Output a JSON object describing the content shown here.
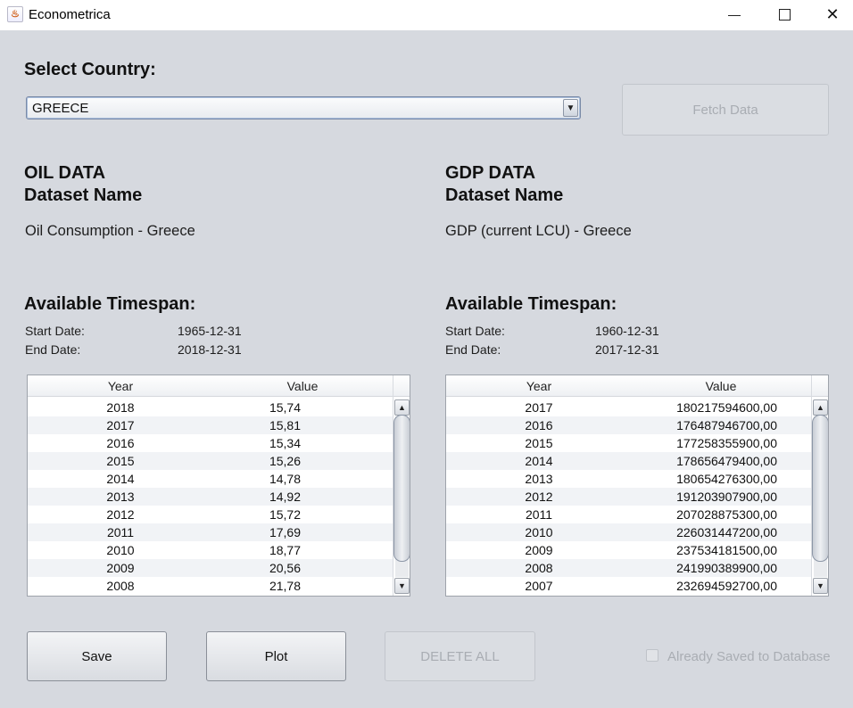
{
  "window": {
    "title": "Econometrica",
    "app_icon_glyph": "♨",
    "minimize_glyph": "",
    "close_glyph": "✕"
  },
  "country": {
    "label": "Select Country:",
    "selected": "GREECE",
    "dropdown_arrow": "▼",
    "fetch_button": "Fetch Data"
  },
  "oil": {
    "heading_line1": "OIL DATA",
    "heading_line2": "Dataset Name",
    "dataset_name": "Oil Consumption - Greece",
    "timespan_heading": "Available Timespan:",
    "start_label": "Start Date:",
    "start_value": "1965-12-31",
    "end_label": "End Date:",
    "end_value": "2018-12-31",
    "columns": [
      "Year",
      "Value"
    ],
    "rows": [
      [
        "2018",
        "15,74"
      ],
      [
        "2017",
        "15,81"
      ],
      [
        "2016",
        "15,34"
      ],
      [
        "2015",
        "15,26"
      ],
      [
        "2014",
        "14,78"
      ],
      [
        "2013",
        "14,92"
      ],
      [
        "2012",
        "15,72"
      ],
      [
        "2011",
        "17,69"
      ],
      [
        "2010",
        "18,77"
      ],
      [
        "2009",
        "20,56"
      ],
      [
        "2008",
        "21,78"
      ]
    ]
  },
  "gdp": {
    "heading_line1": "GDP DATA",
    "heading_line2": "Dataset Name",
    "dataset_name": "GDP (current LCU) - Greece",
    "timespan_heading": "Available Timespan:",
    "start_label": "Start Date:",
    "start_value": "1960-12-31",
    "end_label": "End Date:",
    "end_value": "2017-12-31",
    "columns": [
      "Year",
      "Value"
    ],
    "rows": [
      [
        "2017",
        "180217594600,00"
      ],
      [
        "2016",
        "176487946700,00"
      ],
      [
        "2015",
        "177258355900,00"
      ],
      [
        "2014",
        "178656479400,00"
      ],
      [
        "2013",
        "180654276300,00"
      ],
      [
        "2012",
        "191203907900,00"
      ],
      [
        "2011",
        "207028875300,00"
      ],
      [
        "2010",
        "226031447200,00"
      ],
      [
        "2009",
        "237534181500,00"
      ],
      [
        "2008",
        "241990389900,00"
      ],
      [
        "2007",
        "232694592700,00"
      ]
    ]
  },
  "scroll_glyphs": {
    "up": "▲",
    "down": "▼"
  },
  "actions": {
    "save": "Save",
    "plot": "Plot",
    "delete_all": "DELETE ALL",
    "already_saved": "Already Saved to Database"
  }
}
